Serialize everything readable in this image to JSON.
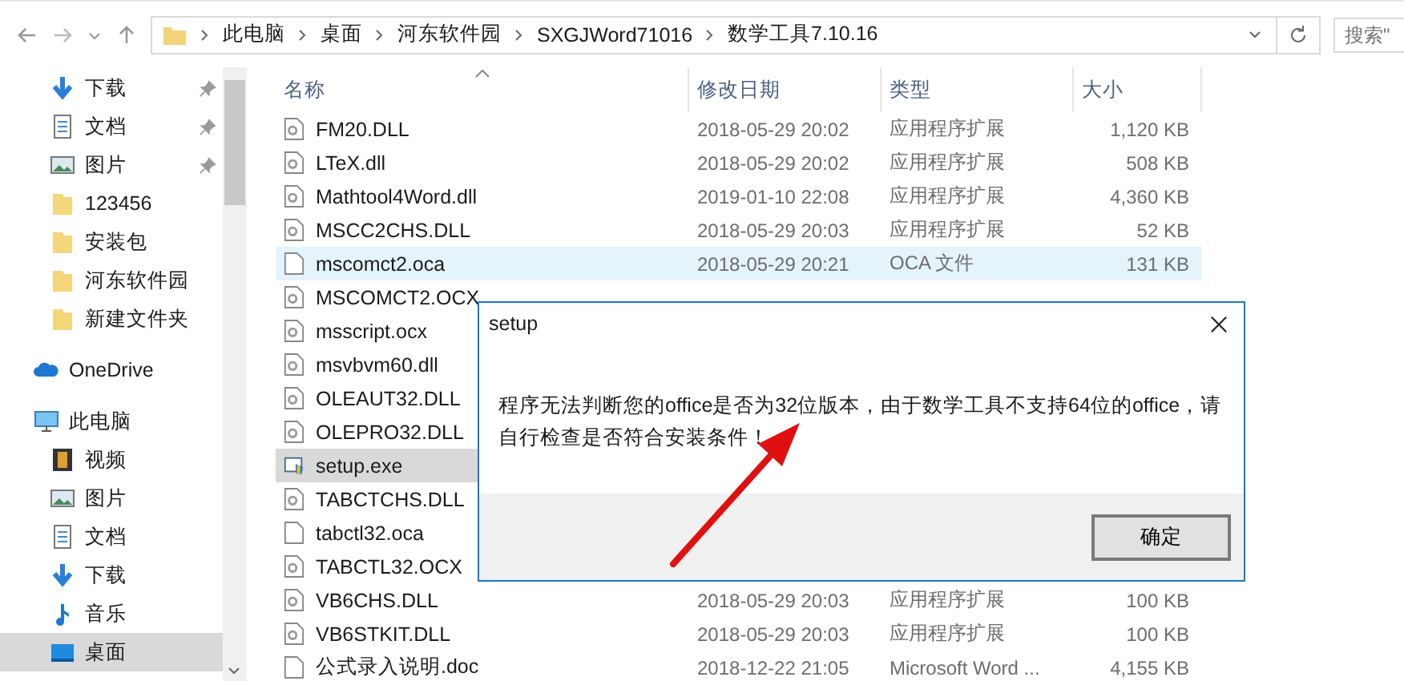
{
  "address_bar": {
    "crumbs": [
      "此电脑",
      "桌面",
      "河东软件园",
      "SXGJWord71016",
      "数学工具7.10.16"
    ]
  },
  "search": {
    "placeholder": "搜索\""
  },
  "sidebar": {
    "items": [
      {
        "label": "下载",
        "kind": "download",
        "pinned": true,
        "selected": false
      },
      {
        "label": "文档",
        "kind": "document",
        "pinned": true,
        "selected": false
      },
      {
        "label": "图片",
        "kind": "picture",
        "pinned": true,
        "selected": false
      },
      {
        "label": "123456",
        "kind": "folder",
        "pinned": false,
        "selected": false
      },
      {
        "label": "安装包",
        "kind": "folder",
        "pinned": false,
        "selected": false
      },
      {
        "label": "河东软件园",
        "kind": "folder",
        "pinned": false,
        "selected": false
      },
      {
        "label": "新建文件夹",
        "kind": "folder",
        "pinned": false,
        "selected": false
      },
      {
        "label": "OneDrive",
        "kind": "cloud",
        "pinned": false,
        "selected": false
      },
      {
        "label": "此电脑",
        "kind": "pc",
        "pinned": false,
        "selected": false,
        "children": [
          {
            "label": "视频",
            "kind": "video",
            "pinned": false,
            "selected": false
          },
          {
            "label": "图片",
            "kind": "picture",
            "pinned": false,
            "selected": false
          },
          {
            "label": "文档",
            "kind": "document",
            "pinned": false,
            "selected": false
          },
          {
            "label": "下载",
            "kind": "download",
            "pinned": false,
            "selected": false
          },
          {
            "label": "音乐",
            "kind": "music",
            "pinned": false,
            "selected": false
          },
          {
            "label": "桌面",
            "kind": "desktop",
            "pinned": false,
            "selected": true
          }
        ]
      }
    ]
  },
  "table": {
    "columns": [
      {
        "label": "名称",
        "sorted": true
      },
      {
        "label": "修改日期",
        "sorted": false
      },
      {
        "label": "类型",
        "sorted": false
      },
      {
        "label": "大小",
        "sorted": false
      }
    ],
    "rows": [
      {
        "name": "FM20.DLL",
        "kind": "dll",
        "date": "2018-05-29 20:02",
        "type": "应用程序扩展",
        "size": "1,120 KB",
        "selected": false,
        "hovered": false
      },
      {
        "name": "LTeX.dll",
        "kind": "dll",
        "date": "2018-05-29 20:02",
        "type": "应用程序扩展",
        "size": "508 KB",
        "selected": false,
        "hovered": false
      },
      {
        "name": "Mathtool4Word.dll",
        "kind": "dll",
        "date": "2019-01-10 22:08",
        "type": "应用程序扩展",
        "size": "4,360 KB",
        "selected": false,
        "hovered": false
      },
      {
        "name": "MSCC2CHS.DLL",
        "kind": "dll",
        "date": "2018-05-29 20:03",
        "type": "应用程序扩展",
        "size": "52 KB",
        "selected": false,
        "hovered": false
      },
      {
        "name": "mscomct2.oca",
        "kind": "blank",
        "date": "2018-05-29 20:21",
        "type": "OCA 文件",
        "size": "131 KB",
        "selected": false,
        "hovered": true
      },
      {
        "name": "MSCOMCT2.OCX",
        "kind": "dll",
        "selected": false,
        "hovered": false
      },
      {
        "name": "msscript.ocx",
        "kind": "dll",
        "selected": false,
        "hovered": false
      },
      {
        "name": "msvbvm60.dll",
        "kind": "dll",
        "selected": false,
        "hovered": false
      },
      {
        "name": "OLEAUT32.DLL",
        "kind": "dll",
        "selected": false,
        "hovered": false
      },
      {
        "name": "OLEPRO32.DLL",
        "kind": "dll",
        "selected": false,
        "hovered": false
      },
      {
        "name": "setup.exe",
        "kind": "exe",
        "selected": true,
        "hovered": false
      },
      {
        "name": "TABCTCHS.DLL",
        "kind": "dll",
        "selected": false,
        "hovered": false
      },
      {
        "name": "tabctl32.oca",
        "kind": "blank",
        "selected": false,
        "hovered": false
      },
      {
        "name": "TABCTL32.OCX",
        "kind": "dll",
        "selected": false,
        "hovered": false
      },
      {
        "name": "VB6CHS.DLL",
        "kind": "dll",
        "date": "2018-05-29 20:03",
        "type": "应用程序扩展",
        "size": "100 KB",
        "selected": false,
        "hovered": false
      },
      {
        "name": "VB6STKIT.DLL",
        "kind": "dll",
        "date": "2018-05-29 20:03",
        "type": "应用程序扩展",
        "size": "100 KB",
        "selected": false,
        "hovered": false
      },
      {
        "name": "公式录入说明.doc",
        "kind": "blank",
        "date": "2018-12-22 21:05",
        "type": "Microsoft Word ...",
        "size": "4,155 KB",
        "selected": false,
        "hovered": false
      }
    ]
  },
  "dialog": {
    "title": "setup",
    "message": "程序无法判断您的office是否为32位版本，由于数学工具不支持64位的office，请自行检查是否符合安装条件！",
    "button": "确定"
  }
}
